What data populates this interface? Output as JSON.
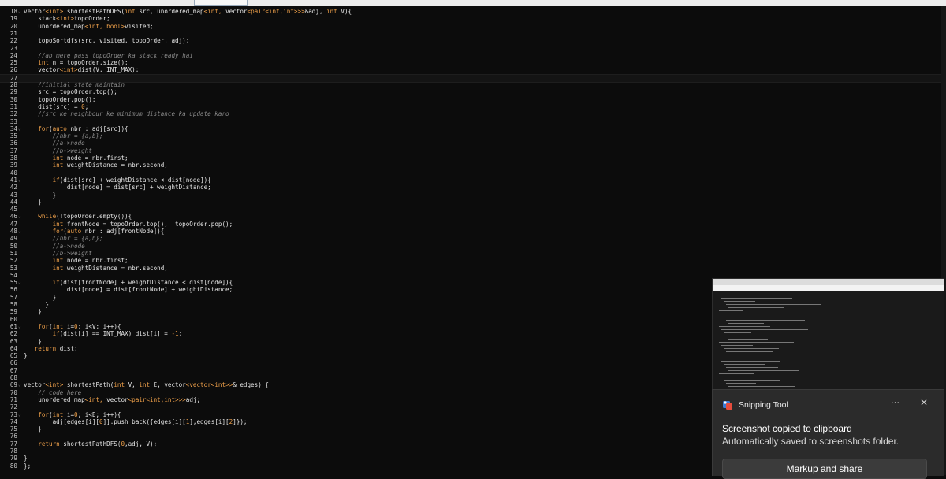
{
  "editor": {
    "lines": [
      {
        "n": "18",
        "fold": true,
        "tokens": [
          [
            "",
            "vector"
          ],
          [
            "ty",
            "<int>"
          ],
          [
            "",
            " shortestPathDFS("
          ],
          [
            "kw",
            "int"
          ],
          [
            "",
            " src, unordered_map"
          ],
          [
            "ty",
            "<int, "
          ],
          [
            "",
            "vector"
          ],
          [
            "ty",
            "<pair<int,int>>>"
          ],
          [
            "",
            "&adj, "
          ],
          [
            "kw",
            "int"
          ],
          [
            "",
            " V){"
          ]
        ]
      },
      {
        "n": "19",
        "tokens": [
          [
            "",
            "    stack"
          ],
          [
            "ty",
            "<int>"
          ],
          [
            "",
            "topoOrder;"
          ]
        ]
      },
      {
        "n": "20",
        "tokens": [
          [
            "",
            "    unordered_map"
          ],
          [
            "ty",
            "<int, bool>"
          ],
          [
            "",
            "visited;"
          ]
        ]
      },
      {
        "n": "21",
        "tokens": []
      },
      {
        "n": "22",
        "tokens": [
          [
            "",
            "    topoSortdfs(src, visited, topoOrder, adj);"
          ]
        ]
      },
      {
        "n": "23",
        "tokens": []
      },
      {
        "n": "24",
        "tokens": [
          [
            "cm",
            "    //ab mere pass topoOrder ka stack ready hai"
          ]
        ]
      },
      {
        "n": "25",
        "tokens": [
          [
            "kw",
            "    int"
          ],
          [
            "",
            " n = topoOrder.size();"
          ]
        ]
      },
      {
        "n": "26",
        "tokens": [
          [
            "",
            "    vector"
          ],
          [
            "ty",
            "<int>"
          ],
          [
            "",
            "dist(V, INT_MAX);"
          ]
        ]
      },
      {
        "n": "27",
        "current": true,
        "tokens": []
      },
      {
        "n": "28",
        "tokens": [
          [
            "cm",
            "    //initial state maintain"
          ]
        ]
      },
      {
        "n": "29",
        "tokens": [
          [
            "",
            "    src = topoOrder.top();"
          ]
        ]
      },
      {
        "n": "30",
        "tokens": [
          [
            "",
            "    topoOrder.pop();"
          ]
        ]
      },
      {
        "n": "31",
        "tokens": [
          [
            "",
            "    dist[src] = "
          ],
          [
            "nm",
            "0"
          ],
          [
            "",
            ";"
          ]
        ]
      },
      {
        "n": "32",
        "tokens": [
          [
            "cm",
            "    //src ke neighbour ke minimum distance ka update karo"
          ]
        ]
      },
      {
        "n": "33",
        "tokens": []
      },
      {
        "n": "34",
        "fold": true,
        "tokens": [
          [
            "kw",
            "    for"
          ],
          [
            "",
            "("
          ],
          [
            "kw",
            "auto"
          ],
          [
            "",
            " nbr : adj[src]){"
          ]
        ]
      },
      {
        "n": "35",
        "tokens": [
          [
            "cm",
            "        //nbr = {a,b};"
          ]
        ]
      },
      {
        "n": "36",
        "tokens": [
          [
            "cm",
            "        //a->node"
          ]
        ]
      },
      {
        "n": "37",
        "tokens": [
          [
            "cm",
            "        //b->weight"
          ]
        ]
      },
      {
        "n": "38",
        "tokens": [
          [
            "kw",
            "        int"
          ],
          [
            "",
            " node = nbr.first;"
          ]
        ]
      },
      {
        "n": "39",
        "tokens": [
          [
            "kw",
            "        int"
          ],
          [
            "",
            " weightDistance = nbr.second;"
          ]
        ]
      },
      {
        "n": "40",
        "tokens": []
      },
      {
        "n": "41",
        "fold": true,
        "tokens": [
          [
            "kw",
            "        if"
          ],
          [
            "",
            "(dist[src] + weightDistance < dist[node]){"
          ]
        ]
      },
      {
        "n": "42",
        "tokens": [
          [
            "",
            "            dist[node] = dist[src] + weightDistance;"
          ]
        ]
      },
      {
        "n": "43",
        "tokens": [
          [
            "",
            "        }"
          ]
        ]
      },
      {
        "n": "44",
        "tokens": [
          [
            "",
            "    }"
          ]
        ]
      },
      {
        "n": "45",
        "tokens": []
      },
      {
        "n": "46",
        "fold": true,
        "tokens": [
          [
            "kw",
            "    while"
          ],
          [
            "",
            "(!topoOrder.empty()){"
          ]
        ]
      },
      {
        "n": "47",
        "tokens": [
          [
            "kw",
            "        int"
          ],
          [
            "",
            " frontNode = topoOrder.top();  topoOrder.pop();"
          ]
        ]
      },
      {
        "n": "48",
        "fold": true,
        "tokens": [
          [
            "kw",
            "        for"
          ],
          [
            "",
            "("
          ],
          [
            "kw",
            "auto"
          ],
          [
            "",
            " nbr : adj[frontNode]){"
          ]
        ]
      },
      {
        "n": "49",
        "tokens": [
          [
            "cm",
            "        //nbr = {a,b};"
          ]
        ]
      },
      {
        "n": "50",
        "tokens": [
          [
            "cm",
            "        //a->node"
          ]
        ]
      },
      {
        "n": "51",
        "tokens": [
          [
            "cm",
            "        //b->weight"
          ]
        ]
      },
      {
        "n": "52",
        "tokens": [
          [
            "kw",
            "        int"
          ],
          [
            "",
            " node = nbr.first;"
          ]
        ]
      },
      {
        "n": "53",
        "tokens": [
          [
            "kw",
            "        int"
          ],
          [
            "",
            " weightDistance = nbr.second;"
          ]
        ]
      },
      {
        "n": "54",
        "tokens": []
      },
      {
        "n": "55",
        "fold": true,
        "tokens": [
          [
            "kw",
            "        if"
          ],
          [
            "",
            "(dist[frontNode] + weightDistance < dist[node]){"
          ]
        ]
      },
      {
        "n": "56",
        "tokens": [
          [
            "",
            "            dist[node] = dist[frontNode] + weightDistance;"
          ]
        ]
      },
      {
        "n": "57",
        "tokens": [
          [
            "",
            "        }"
          ]
        ]
      },
      {
        "n": "58",
        "tokens": [
          [
            "",
            "      }"
          ]
        ]
      },
      {
        "n": "59",
        "tokens": [
          [
            "",
            "    }"
          ]
        ]
      },
      {
        "n": "60",
        "tokens": []
      },
      {
        "n": "61",
        "fold": true,
        "tokens": [
          [
            "kw",
            "    for"
          ],
          [
            "",
            "("
          ],
          [
            "kw",
            "int"
          ],
          [
            "",
            " i="
          ],
          [
            "nm",
            "0"
          ],
          [
            "",
            "; i<V; i++){"
          ]
        ]
      },
      {
        "n": "62",
        "tokens": [
          [
            "kw",
            "        if"
          ],
          [
            "",
            "(dist[i] == INT_MAX) dist[i] = "
          ],
          [
            "nm",
            "-1"
          ],
          [
            "",
            ";"
          ]
        ]
      },
      {
        "n": "63",
        "tokens": [
          [
            "",
            "    }"
          ]
        ]
      },
      {
        "n": "64",
        "tokens": [
          [
            "kw",
            "   return"
          ],
          [
            "",
            " dist;"
          ]
        ]
      },
      {
        "n": "65",
        "tokens": [
          [
            "",
            "}"
          ]
        ]
      },
      {
        "n": "66",
        "tokens": []
      },
      {
        "n": "67",
        "tokens": []
      },
      {
        "n": "68",
        "tokens": []
      },
      {
        "n": "69",
        "fold": true,
        "tokens": [
          [
            "",
            "vector"
          ],
          [
            "ty",
            "<int>"
          ],
          [
            "",
            " shortestPath("
          ],
          [
            "kw",
            "int"
          ],
          [
            "",
            " V, "
          ],
          [
            "kw",
            "int"
          ],
          [
            "",
            " E, vector"
          ],
          [
            "ty",
            "<vector<int>>"
          ],
          [
            "",
            "& edges) {"
          ]
        ]
      },
      {
        "n": "70",
        "tokens": [
          [
            "cm",
            "    // code here"
          ]
        ]
      },
      {
        "n": "71",
        "tokens": [
          [
            "",
            "    unordered_map"
          ],
          [
            "ty",
            "<int, "
          ],
          [
            "",
            "vector"
          ],
          [
            "ty",
            "<pair<int,int>>>"
          ],
          [
            "",
            "adj;"
          ]
        ]
      },
      {
        "n": "72",
        "tokens": []
      },
      {
        "n": "73",
        "fold": true,
        "tokens": [
          [
            "kw",
            "    for"
          ],
          [
            "",
            "("
          ],
          [
            "kw",
            "int"
          ],
          [
            "",
            " i="
          ],
          [
            "nm",
            "0"
          ],
          [
            "",
            "; i<E; i++){"
          ]
        ]
      },
      {
        "n": "74",
        "tokens": [
          [
            "",
            "        adj[edges[i]["
          ],
          [
            "nm",
            "0"
          ],
          [
            "",
            "]].push_back({edges[i]["
          ],
          [
            "nm",
            "1"
          ],
          [
            "",
            "],edges[i]["
          ],
          [
            "nm",
            "2"
          ],
          [
            "",
            "]});"
          ]
        ]
      },
      {
        "n": "75",
        "tokens": [
          [
            "",
            "    }"
          ]
        ]
      },
      {
        "n": "76",
        "tokens": []
      },
      {
        "n": "77",
        "tokens": [
          [
            "kw",
            "    return"
          ],
          [
            "",
            " shortestPathDFS("
          ],
          [
            "nm",
            "0"
          ],
          [
            "",
            ",adj, V);"
          ]
        ]
      },
      {
        "n": "78",
        "tokens": []
      },
      {
        "n": "79",
        "tokens": [
          [
            "",
            "}"
          ]
        ]
      },
      {
        "n": "80",
        "tokens": [
          [
            "",
            "};"
          ]
        ]
      }
    ]
  },
  "notification": {
    "app_icon": "snipping-tool-icon",
    "app_name": "Snipping Tool",
    "more_label": "···",
    "close_label": "✕",
    "title": "Screenshot copied to clipboard",
    "message": "Automatically saved to screenshots folder.",
    "action_label": "Markup and share"
  }
}
